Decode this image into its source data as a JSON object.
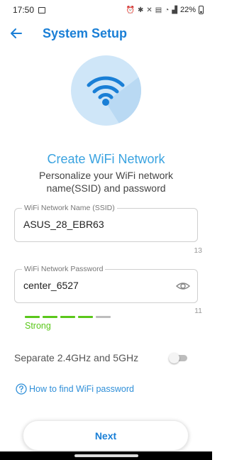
{
  "status_bar": {
    "time": "17:50",
    "icons_left": [
      "image-icon"
    ],
    "icons_right": [
      "alarm-icon",
      "bluetooth-icon",
      "mute-icon",
      "volte-icon",
      "wifi-icon",
      "signal-icon"
    ],
    "battery": "22%"
  },
  "header": {
    "title": "System Setup",
    "back_icon": "arrow-left-icon"
  },
  "hero": {
    "icon": "wifi-icon"
  },
  "section": {
    "title": "Create WiFi Network",
    "subtitle": "Personalize your WiFi network name(SSID) and password"
  },
  "ssid_field": {
    "label": "WiFi Network Name (SSID)",
    "value": "ASUS_28_EBR63",
    "counter": "13"
  },
  "password_field": {
    "label": "WiFi Network Password",
    "value": "center_6527",
    "counter": "11",
    "visibility_icon": "eye-icon"
  },
  "strength": {
    "label": "Strong",
    "filled_segments": 4,
    "total_segments": 5
  },
  "separate_bands": {
    "label": "Separate 2.4GHz and 5GHz",
    "enabled": false
  },
  "help_link": {
    "text": "How to find WiFi password",
    "icon": "help-circle-icon"
  },
  "next_button": {
    "label": "Next"
  },
  "colors": {
    "primary": "#1a7fd6",
    "section_title": "#3aa3e0",
    "hero_bg": "#cfe6f8",
    "strength_active": "#5ac71a",
    "strength_inactive": "#bdbdbd"
  }
}
